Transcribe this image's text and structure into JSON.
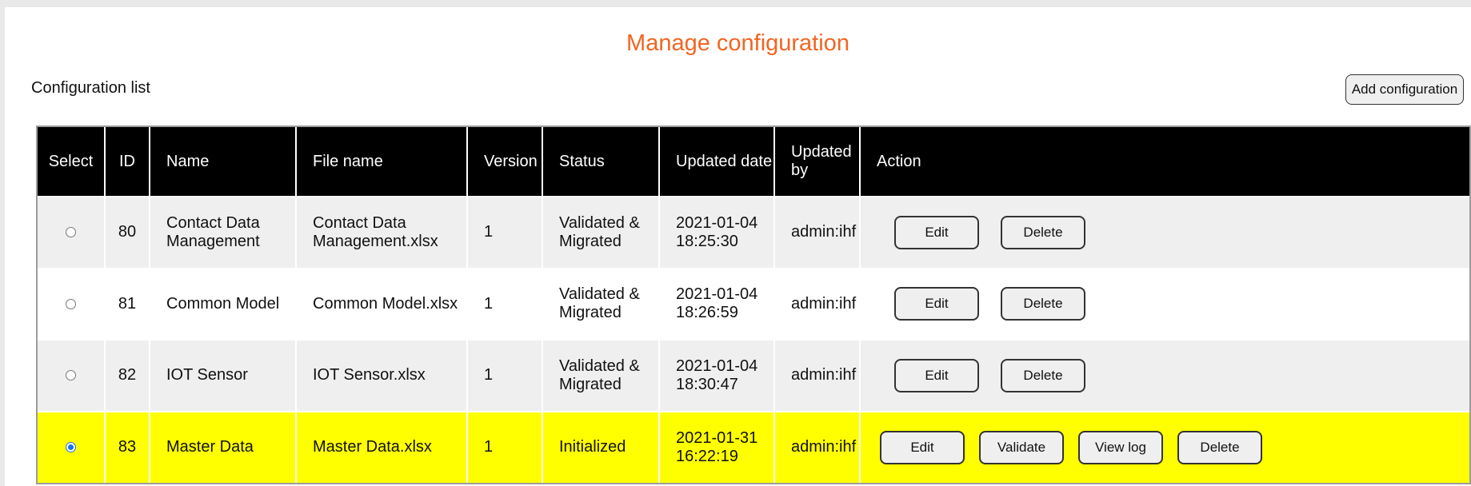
{
  "page": {
    "title": "Manage configuration",
    "list_label": "Configuration list",
    "add_button": "Add configuration"
  },
  "table": {
    "headers": {
      "select": "Select",
      "id": "ID",
      "name": "Name",
      "file_name": "File name",
      "version": "Version",
      "status": "Status",
      "updated_date": "Updated date",
      "updated_by": "Updated by",
      "action": "Action"
    },
    "rows": [
      {
        "id": "80",
        "name": "Contact Data Management",
        "file_name": "Contact Data Management.xlsx",
        "version": "1",
        "status": "Validated & Migrated",
        "updated_date": "2021-01-04 18:25:30",
        "updated_by": "admin:ihf",
        "selected": false,
        "actions": [
          "Edit",
          "Delete"
        ]
      },
      {
        "id": "81",
        "name": "Common Model",
        "file_name": "Common Model.xlsx",
        "version": "1",
        "status": "Validated & Migrated",
        "updated_date": "2021-01-04 18:26:59",
        "updated_by": "admin:ihf",
        "selected": false,
        "actions": [
          "Edit",
          "Delete"
        ]
      },
      {
        "id": "82",
        "name": "IOT Sensor",
        "file_name": "IOT Sensor.xlsx",
        "version": "1",
        "status": "Validated & Migrated",
        "updated_date": "2021-01-04 18:30:47",
        "updated_by": "admin:ihf",
        "selected": false,
        "actions": [
          "Edit",
          "Delete"
        ]
      },
      {
        "id": "83",
        "name": "Master Data",
        "file_name": "Master Data.xlsx",
        "version": "1",
        "status": "Initialized",
        "updated_date": "2021-01-31 16:22:19",
        "updated_by": "admin:ihf",
        "selected": true,
        "actions": [
          "Edit",
          "Validate",
          "View log",
          "Delete"
        ]
      }
    ]
  },
  "colors": {
    "title": "#f26522",
    "header_bg": "#000000",
    "row_alt_bg": "#efefef",
    "selected_row_bg": "#ffff00",
    "radio_checked": "#1a73e8"
  }
}
